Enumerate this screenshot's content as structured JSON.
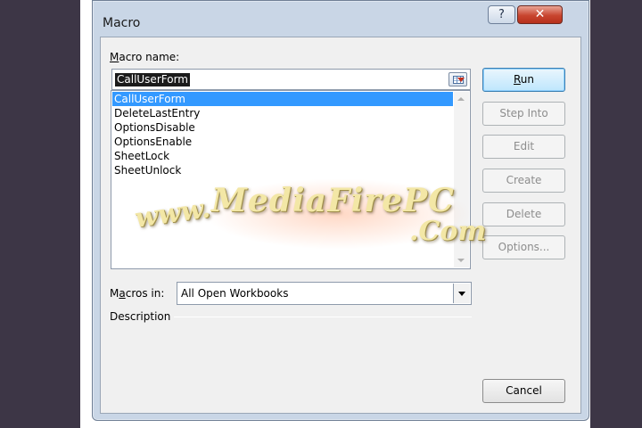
{
  "dialog": {
    "title": "Macro",
    "help_label": "?",
    "close_label": "✕"
  },
  "macro_name": {
    "label_pre": "",
    "label_key": "M",
    "label_post": "acro name:",
    "value": "CallUserForm"
  },
  "macro_list": {
    "items": [
      "CallUserForm",
      "DeleteLastEntry",
      "OptionsDisable",
      "OptionsEnable",
      "SheetLock",
      "SheetUnlock"
    ],
    "selected_index": 0
  },
  "buttons": {
    "run_key": "R",
    "run_rest": "un",
    "step_into": "Step Into",
    "edit": "Edit",
    "create": "Create",
    "delete": "Delete",
    "options": "Options...",
    "cancel": "Cancel"
  },
  "macros_in": {
    "label_pre": "M",
    "label_key": "a",
    "label_post": "cros in:",
    "value": "All Open Workbooks"
  },
  "description": {
    "label": "Description"
  },
  "watermark": {
    "www": "www.",
    "main": "MediaFirePC",
    "com": ".Com"
  },
  "colors": {
    "backdrop": "#3d3646",
    "selection": "#3399ff",
    "close_button": "#c8452f"
  }
}
